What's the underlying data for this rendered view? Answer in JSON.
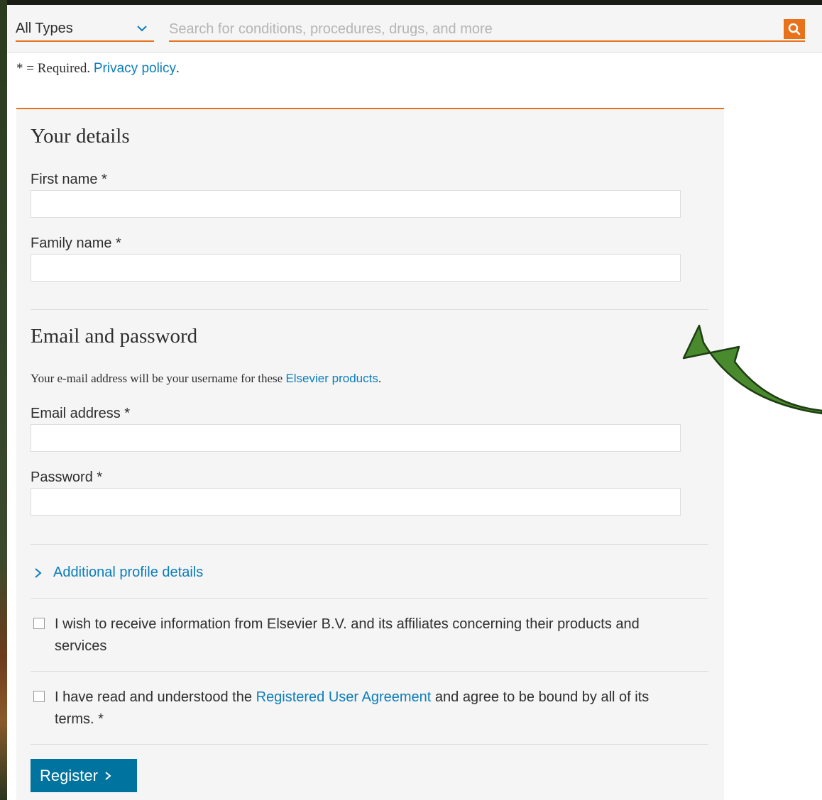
{
  "search": {
    "type_value": "All Types",
    "placeholder": "Search for conditions, procedures, drugs, and more"
  },
  "notice": {
    "required_text": "* = Required.",
    "privacy_link": "Privacy policy",
    "period": "."
  },
  "your_details": {
    "heading": "Your details",
    "first_name_label": "First name *",
    "family_name_label": "Family name *"
  },
  "email_password": {
    "heading": "Email and password",
    "note_prefix": "Your e-mail address will be your username for these",
    "note_link": "Elsevier products",
    "note_suffix": ".",
    "email_label": "Email address *",
    "password_label": "Password *"
  },
  "additional": {
    "label": "Additional profile details"
  },
  "consent": {
    "marketing_text": "I wish to receive information from Elsevier B.V. and its affiliates concerning their products and services",
    "agreement_prefix": "I have read and understood the",
    "agreement_link": "Registered User Agreement",
    "agreement_suffix": "and agree to be bound by all of its terms. *"
  },
  "actions": {
    "register_label": "Register"
  },
  "colors": {
    "accent": "#e9711c",
    "link": "#0c7dbb",
    "button": "#00739e",
    "annotation_arrow": "#4a8a2e"
  }
}
